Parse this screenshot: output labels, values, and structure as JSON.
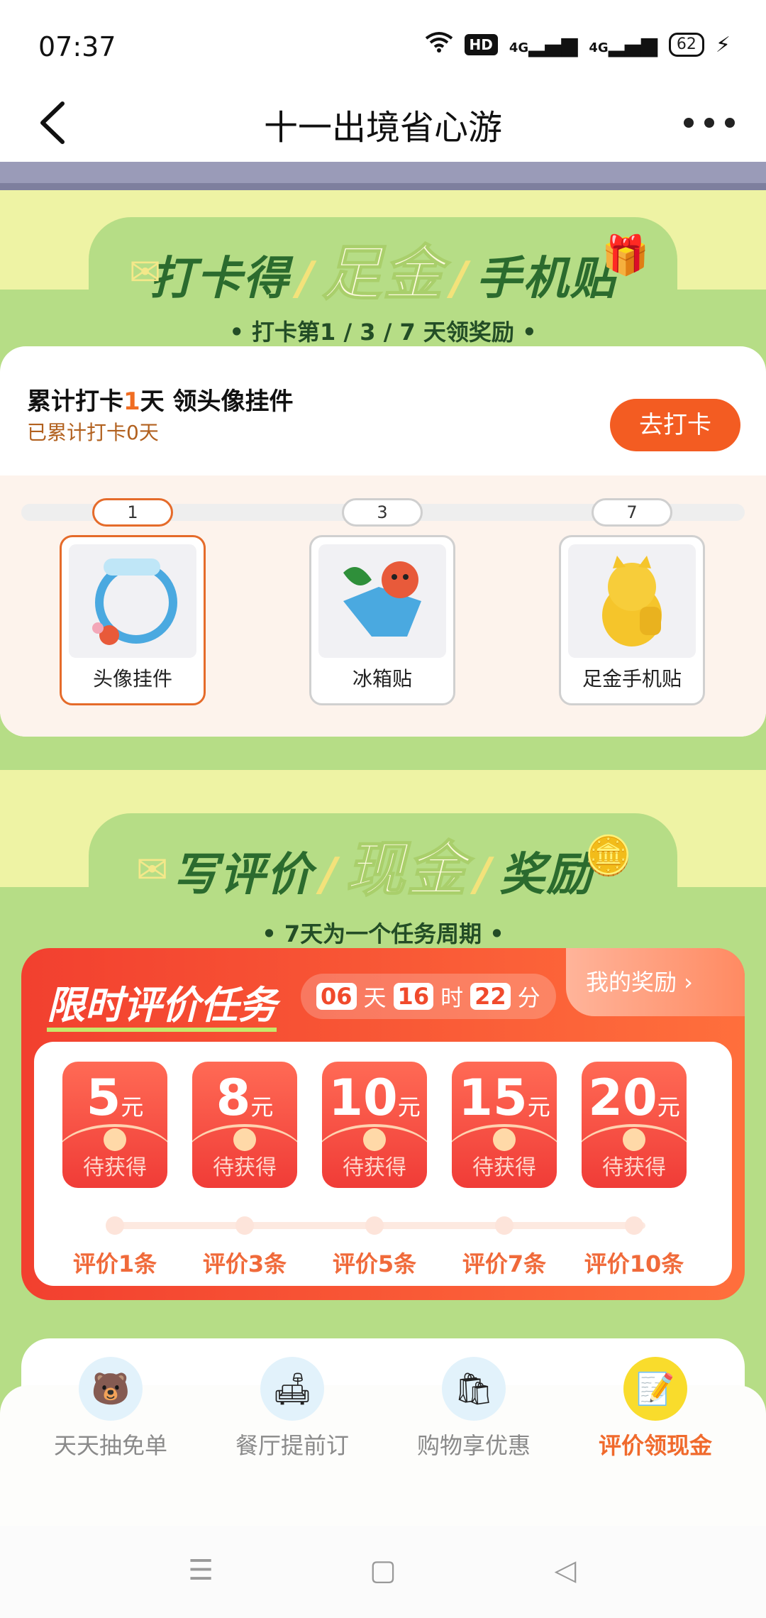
{
  "status_bar": {
    "time": "07:37",
    "battery": "62",
    "network": "4G",
    "hd": "HD"
  },
  "nav": {
    "title": "十一出境省心游"
  },
  "punch_section": {
    "title_left": "打卡得",
    "title_highlight": "足金",
    "title_right": "手机贴",
    "subtitle": "• 打卡第1 / 3 / 7 天领奖励 •",
    "card": {
      "title_prefix": "累计打卡",
      "title_days": "1",
      "title_suffix": "天 领头像挂件",
      "subtitle": "已累计打卡0天",
      "button": "去打卡"
    },
    "steps": [
      {
        "day": "1",
        "label": "头像挂件"
      },
      {
        "day": "3",
        "label": "冰箱贴"
      },
      {
        "day": "7",
        "label": "足金手机贴"
      }
    ]
  },
  "review_section": {
    "title_left": "写评价",
    "title_highlight": "现金",
    "title_right": "奖励",
    "subtitle": "• 7天为一个任务周期 •",
    "task": {
      "title": "限时评价任务",
      "timer": {
        "days": "06",
        "days_unit": "天",
        "hours": "16",
        "hours_unit": "时",
        "minutes": "22",
        "minutes_unit": "分"
      },
      "my_reward": "我的奖励 ›",
      "rewards": [
        {
          "amount": "5",
          "unit": "元",
          "status": "待获得",
          "req": "评价1条"
        },
        {
          "amount": "8",
          "unit": "元",
          "status": "待获得",
          "req": "评价3条"
        },
        {
          "amount": "10",
          "unit": "元",
          "status": "待获得",
          "req": "评价5条"
        },
        {
          "amount": "15",
          "unit": "元",
          "status": "待获得",
          "req": "评价7条"
        },
        {
          "amount": "20",
          "unit": "元",
          "status": "待获得",
          "req": "评价10条"
        }
      ]
    }
  },
  "tabbar": [
    {
      "label": "天天抽免单",
      "icon": "bear-icon"
    },
    {
      "label": "餐厅提前订",
      "icon": "sofa-icon"
    },
    {
      "label": "购物享优惠",
      "icon": "shopping-bag-icon"
    },
    {
      "label": "评价领现金",
      "icon": "notepad-icon"
    }
  ],
  "colors": {
    "accent": "#f35c22",
    "green_bg": "#b6dd86",
    "yellow_bg": "#eef3a4",
    "red_card": "#f2402f"
  }
}
